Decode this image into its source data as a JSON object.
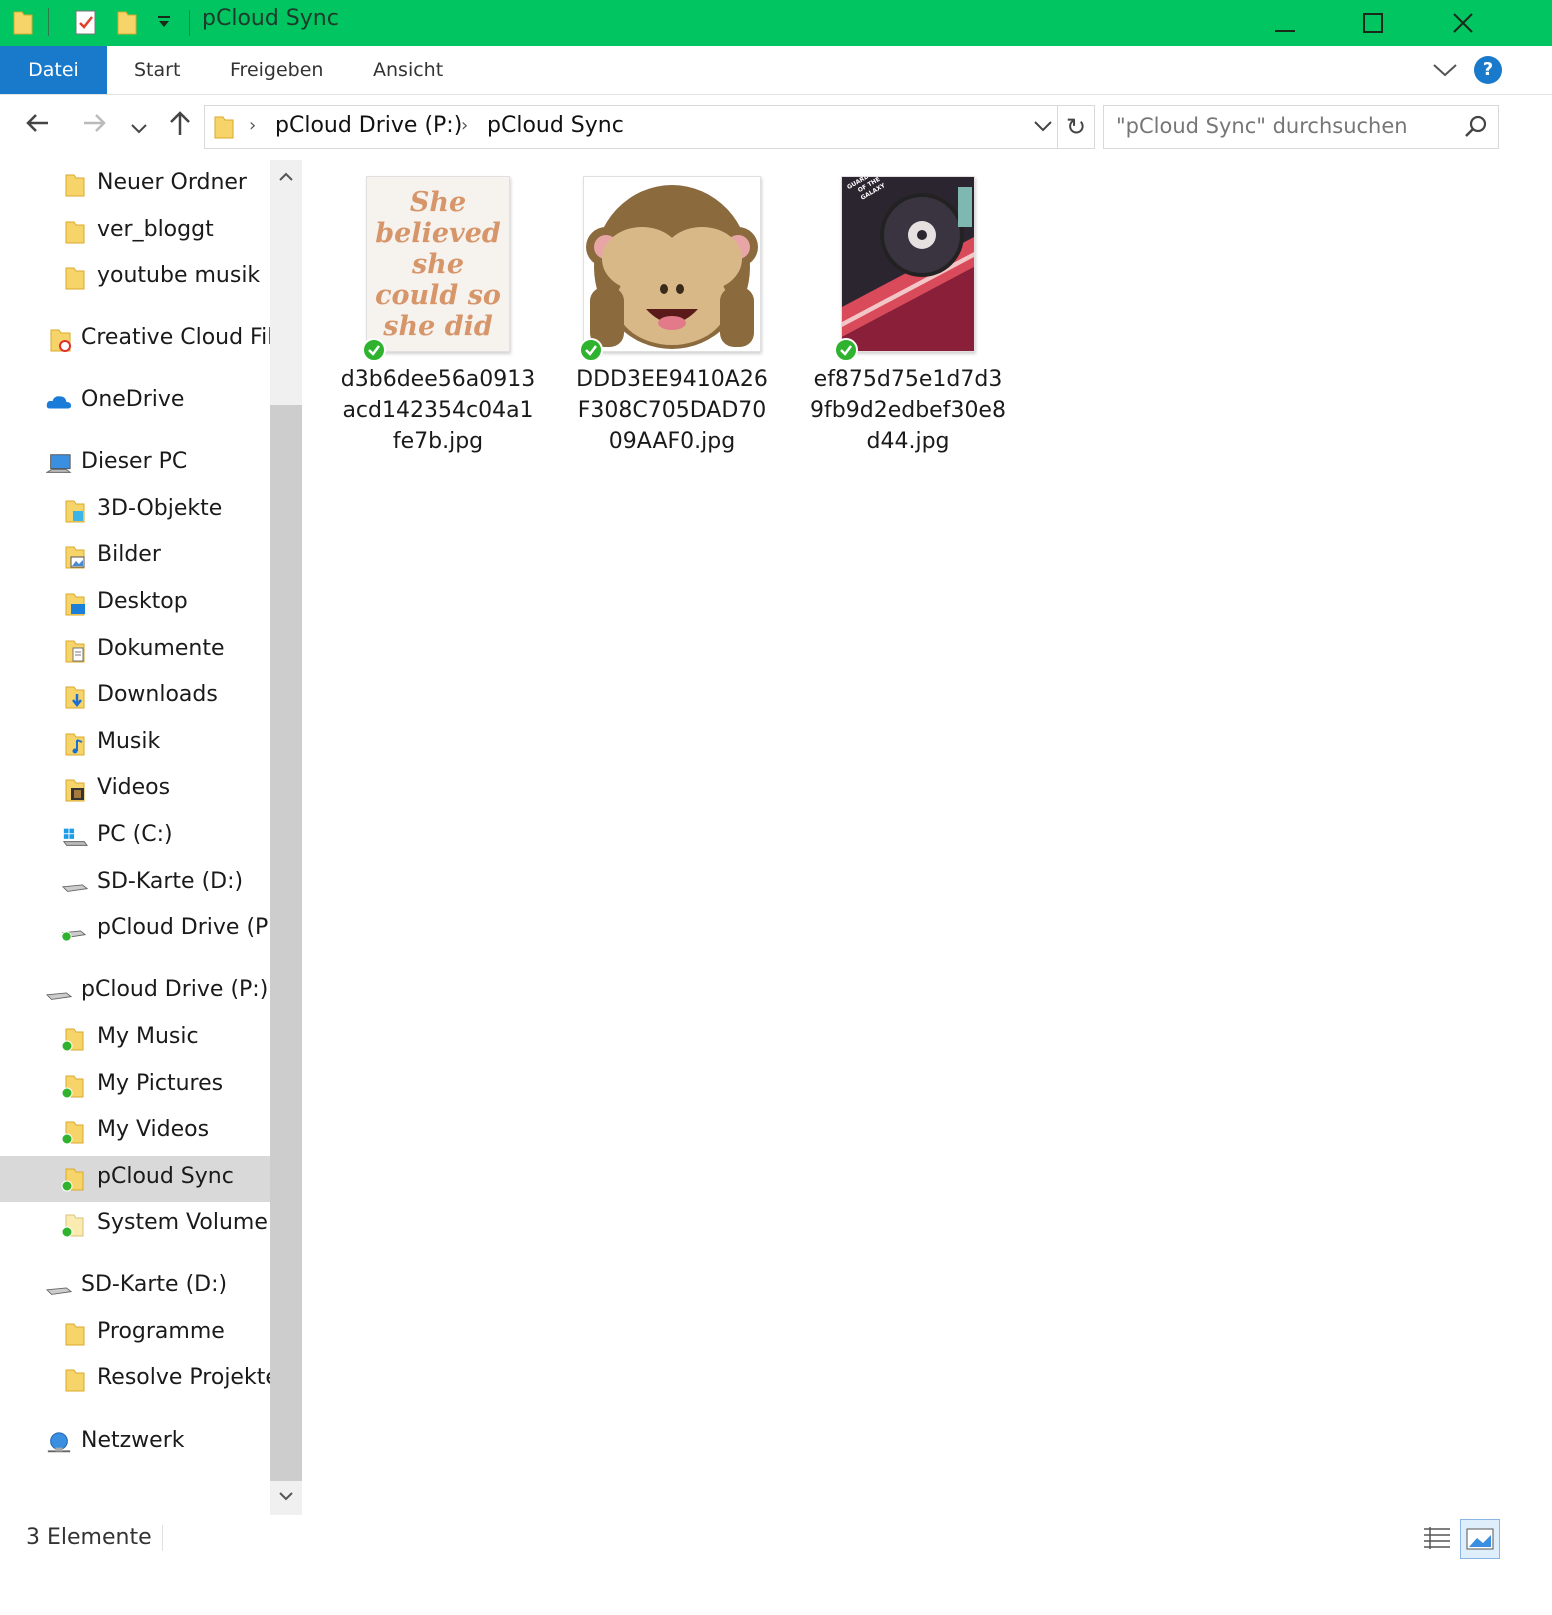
{
  "window": {
    "title": "pCloud Sync",
    "accent_color": "#00c561",
    "ribbon_active_color": "#1979ca"
  },
  "ribbon": {
    "tabs": [
      {
        "label": "Datei",
        "active": true
      },
      {
        "label": "Start",
        "active": false
      },
      {
        "label": "Freigeben",
        "active": false
      },
      {
        "label": "Ansicht",
        "active": false
      }
    ],
    "help_label": "?"
  },
  "address": {
    "crumbs": [
      "pCloud Drive (P:)",
      "pCloud Sync"
    ],
    "search_placeholder": "\"pCloud Sync\" durchsuchen"
  },
  "sidebar": {
    "items": [
      {
        "label": "Neuer Ordner",
        "icon": "folder-icon"
      },
      {
        "label": "ver_bloggt",
        "icon": "folder-icon"
      },
      {
        "label": "youtube musik",
        "icon": "folder-icon"
      },
      {
        "label": "Creative Cloud Files",
        "icon": "creative-cloud-folder-icon"
      },
      {
        "label": "OneDrive",
        "icon": "onedrive-cloud-icon"
      },
      {
        "label": "Dieser PC",
        "icon": "computer-icon"
      },
      {
        "label": "3D-Objekte",
        "icon": "3d-objects-folder-icon"
      },
      {
        "label": "Bilder",
        "icon": "pictures-folder-icon"
      },
      {
        "label": "Desktop",
        "icon": "desktop-folder-icon"
      },
      {
        "label": "Dokumente",
        "icon": "documents-folder-icon"
      },
      {
        "label": "Downloads",
        "icon": "downloads-folder-icon"
      },
      {
        "label": "Musik",
        "icon": "music-folder-icon"
      },
      {
        "label": "Videos",
        "icon": "videos-folder-icon"
      },
      {
        "label": "PC (C:)",
        "icon": "windows-drive-icon"
      },
      {
        "label": "SD-Karte (D:)",
        "icon": "drive-icon"
      },
      {
        "label": "pCloud Drive (P:)",
        "icon": "synced-drive-icon"
      },
      {
        "label": "pCloud Drive (P:)",
        "icon": "drive-icon"
      },
      {
        "label": "My Music",
        "icon": "synced-folder-icon"
      },
      {
        "label": "My Pictures",
        "icon": "synced-folder-icon"
      },
      {
        "label": "My Videos",
        "icon": "synced-folder-icon"
      },
      {
        "label": "pCloud Sync",
        "icon": "synced-folder-icon",
        "selected": true
      },
      {
        "label": "System Volume Information",
        "icon": "synced-folder-icon"
      },
      {
        "label": "SD-Karte (D:)",
        "icon": "drive-icon"
      },
      {
        "label": "Programme",
        "icon": "folder-icon"
      },
      {
        "label": "Resolve Projekte",
        "icon": "folder-icon"
      },
      {
        "label": "Netzwerk",
        "icon": "network-icon"
      }
    ]
  },
  "files": [
    {
      "name": "d3b6dee56a0913acd142354c04a1fe7b.jpg",
      "thumb": "quote-thumbnail",
      "thumb_text": "She believed she could so she did",
      "synced": true
    },
    {
      "name": "DDD3EE9410A26F308C705DAD7009AAF0.jpg",
      "thumb": "see-no-evil-monkey-thumbnail",
      "synced": true
    },
    {
      "name": "ef875d75e1d7d39fb9d2edbef30e8d44.jpg",
      "thumb": "cassette-poster-thumbnail",
      "thumb_text": "GUARDIANS OF THE GALAXY",
      "synced": true
    }
  ],
  "status": {
    "count_label": "3 Elemente"
  }
}
